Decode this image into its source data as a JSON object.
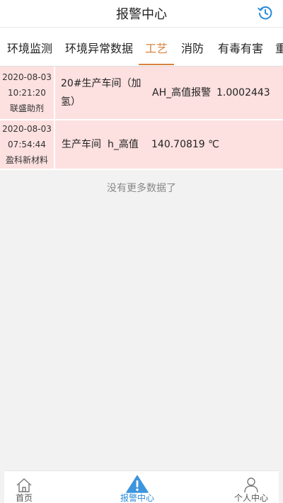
{
  "header": {
    "title": "报警中心"
  },
  "tabs": [
    {
      "label": "环境监测",
      "active": false
    },
    {
      "label": "环境异常数据",
      "active": false
    },
    {
      "label": "工艺",
      "active": true
    },
    {
      "label": "消防",
      "active": false
    },
    {
      "label": "有毒有害",
      "active": false
    },
    {
      "label": "重",
      "active": false
    }
  ],
  "alarms": [
    {
      "date": "2020-08-03",
      "time": "10:21:20",
      "company": "联盛助剂",
      "location": "20#生产车间（加氢）",
      "alarm_type": "AH_高值报警",
      "value": "1.0002443"
    },
    {
      "date": "2020-08-03",
      "time": "07:54:44",
      "company": "盈科新材料",
      "location": "生产车间",
      "alarm_type": "h_高值",
      "value": "140.70819 ℃"
    }
  ],
  "list_footer": "没有更多数据了",
  "bottom_nav": [
    {
      "label": "首页",
      "icon": "home-icon",
      "active": false
    },
    {
      "label": "报警中心",
      "icon": "warning-icon",
      "active": true
    },
    {
      "label": "个人中心",
      "icon": "user-icon",
      "active": false
    }
  ],
  "colors": {
    "accent_tab": "#d9823b",
    "accent_nav": "#2b8bd8",
    "row_bg": "#fde0e0"
  }
}
